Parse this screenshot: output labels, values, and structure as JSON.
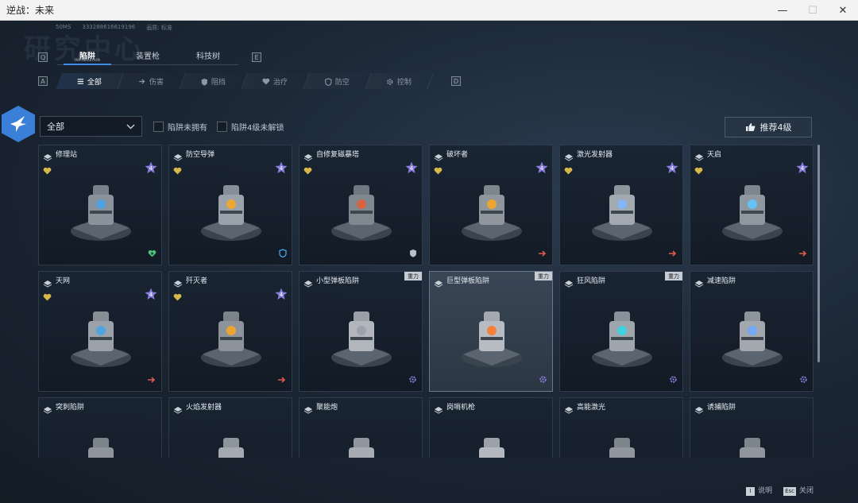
{
  "window": {
    "title": "逆战：未来",
    "minimize": "—",
    "maximize": "☐",
    "close": "✕"
  },
  "bg_title": "研究中心",
  "meta": {
    "ms": "50MS",
    "id": "333288616619196",
    "quality_label": "画质:",
    "quality_value": "标准"
  },
  "main_tabs": {
    "left_key": "Q",
    "right_key": "E",
    "items": [
      {
        "label": "陷阱",
        "sub": "INSTALLATION",
        "active": true
      },
      {
        "label": "装置枪",
        "active": false
      },
      {
        "label": "科技树",
        "active": false
      }
    ]
  },
  "sub_tabs": {
    "left_key": "A",
    "right_key": "D",
    "items": [
      {
        "label": "全部",
        "icon": "list-icon",
        "active": true
      },
      {
        "label": "伤害",
        "icon": "arrow-right-icon"
      },
      {
        "label": "阻挡",
        "icon": "shield-icon"
      },
      {
        "label": "治疗",
        "icon": "heal-icon"
      },
      {
        "label": "防空",
        "icon": "air-defense-icon"
      },
      {
        "label": "控制",
        "icon": "gear-icon"
      }
    ]
  },
  "filters": {
    "dropdown_value": "全部",
    "check_unowned": "陷阱未拥有",
    "check_level4_locked": "陷阱4级未解锁",
    "recommend_label": "推荐4级"
  },
  "colors": {
    "accent": "#3e8be6",
    "gold": "#d6b84a",
    "red": "#e05a4a",
    "green": "#4cc27a",
    "purple": "#8a7fe0"
  },
  "cards": [
    {
      "name": "修理站",
      "heart": true,
      "star": "4",
      "corner": "heal-icon",
      "art": "repair"
    },
    {
      "name": "防空导弹",
      "heart": true,
      "star": "4",
      "corner": "air-defense-icon",
      "art": "missile"
    },
    {
      "name": "自修复磁暴塔",
      "heart": true,
      "star": "4",
      "corner": "shield-icon",
      "art": "tower"
    },
    {
      "name": "破坏者",
      "heart": true,
      "star": "4",
      "corner": "arrow-right-icon",
      "art": "turret"
    },
    {
      "name": "激光发射器",
      "heart": true,
      "star": "4",
      "corner": "arrow-right-icon",
      "art": "laser"
    },
    {
      "name": "天启",
      "heart": true,
      "star": "4",
      "corner": "arrow-right-icon",
      "art": "orb"
    },
    {
      "name": "天网",
      "heart": true,
      "star": "4",
      "corner": "arrow-right-icon",
      "art": "skynet"
    },
    {
      "name": "歼灭者",
      "heart": true,
      "star": "4",
      "corner": "arrow-right-icon",
      "art": "cannon"
    },
    {
      "name": "小型弹板陷阱",
      "tag": "重力",
      "corner": "gear-icon",
      "art": "pad"
    },
    {
      "name": "巨型弹板陷阱",
      "tag": "重力",
      "corner": "gear-icon",
      "art": "bigpad",
      "selected": true
    },
    {
      "name": "狂风陷阱",
      "tag": "重力",
      "corner": "gear-icon",
      "art": "fan"
    },
    {
      "name": "减速陷阱",
      "corner": "gear-icon",
      "art": "slow"
    },
    {
      "name": "突刺陷阱",
      "art": "spike"
    },
    {
      "name": "火焰发射器",
      "art": "flame"
    },
    {
      "name": "聚能炮",
      "art": "cannon2"
    },
    {
      "name": "岗哨机枪",
      "art": "sentry"
    },
    {
      "name": "高能激光",
      "art": "hlaser"
    },
    {
      "name": "诱捕陷阱",
      "art": "lure"
    }
  ],
  "hints": [
    {
      "key": "I",
      "label": "说明"
    },
    {
      "key": "Esc",
      "label": "关闭"
    }
  ]
}
